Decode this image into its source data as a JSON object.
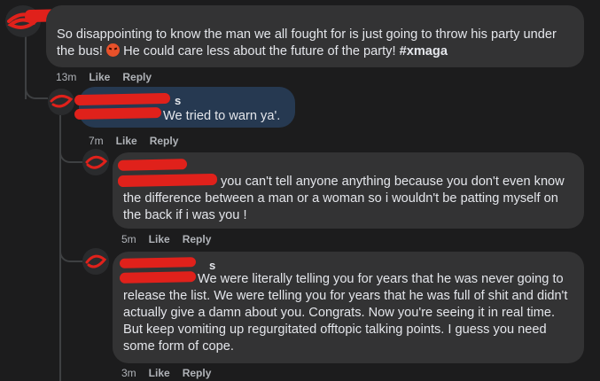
{
  "comments": [
    {
      "text_before_emoji": "So disappointing to know the man we all fought for is just going to throw his party under the bus!",
      "text_after_emoji": "He could care less about the future of the party!",
      "hashtag": "#xmaga",
      "time": "13m",
      "like_label": "Like",
      "reply_label": "Reply"
    },
    {
      "name_visible": "s",
      "text": "We tried to warn ya'.",
      "time": "7m",
      "like_label": "Like",
      "reply_label": "Reply"
    },
    {
      "text": "you can't tell anyone anything because you don't even know the difference between a man or a woman so i wouldn't be patting myself on the back if i was you !",
      "time": "5m",
      "like_label": "Like",
      "reply_label": "Reply"
    },
    {
      "name_visible": "s",
      "text": "We were literally telling you for years that he was never going to release the list. We were telling you for years that he was full of shit and didn't actually give a damn about you. Congrats. Now you're seeing it in real time. But keep vomiting up regurgitated offtopic talking points. I guess you need some form of cope.",
      "time": "3m",
      "like_label": "Like",
      "reply_label": "Reply"
    }
  ],
  "colors": {
    "background": "#1c1c1d",
    "bubble": "#333334",
    "highlight_bubble": "#263951",
    "redaction": "#e0211b",
    "muted_text": "#b0b3b8"
  }
}
